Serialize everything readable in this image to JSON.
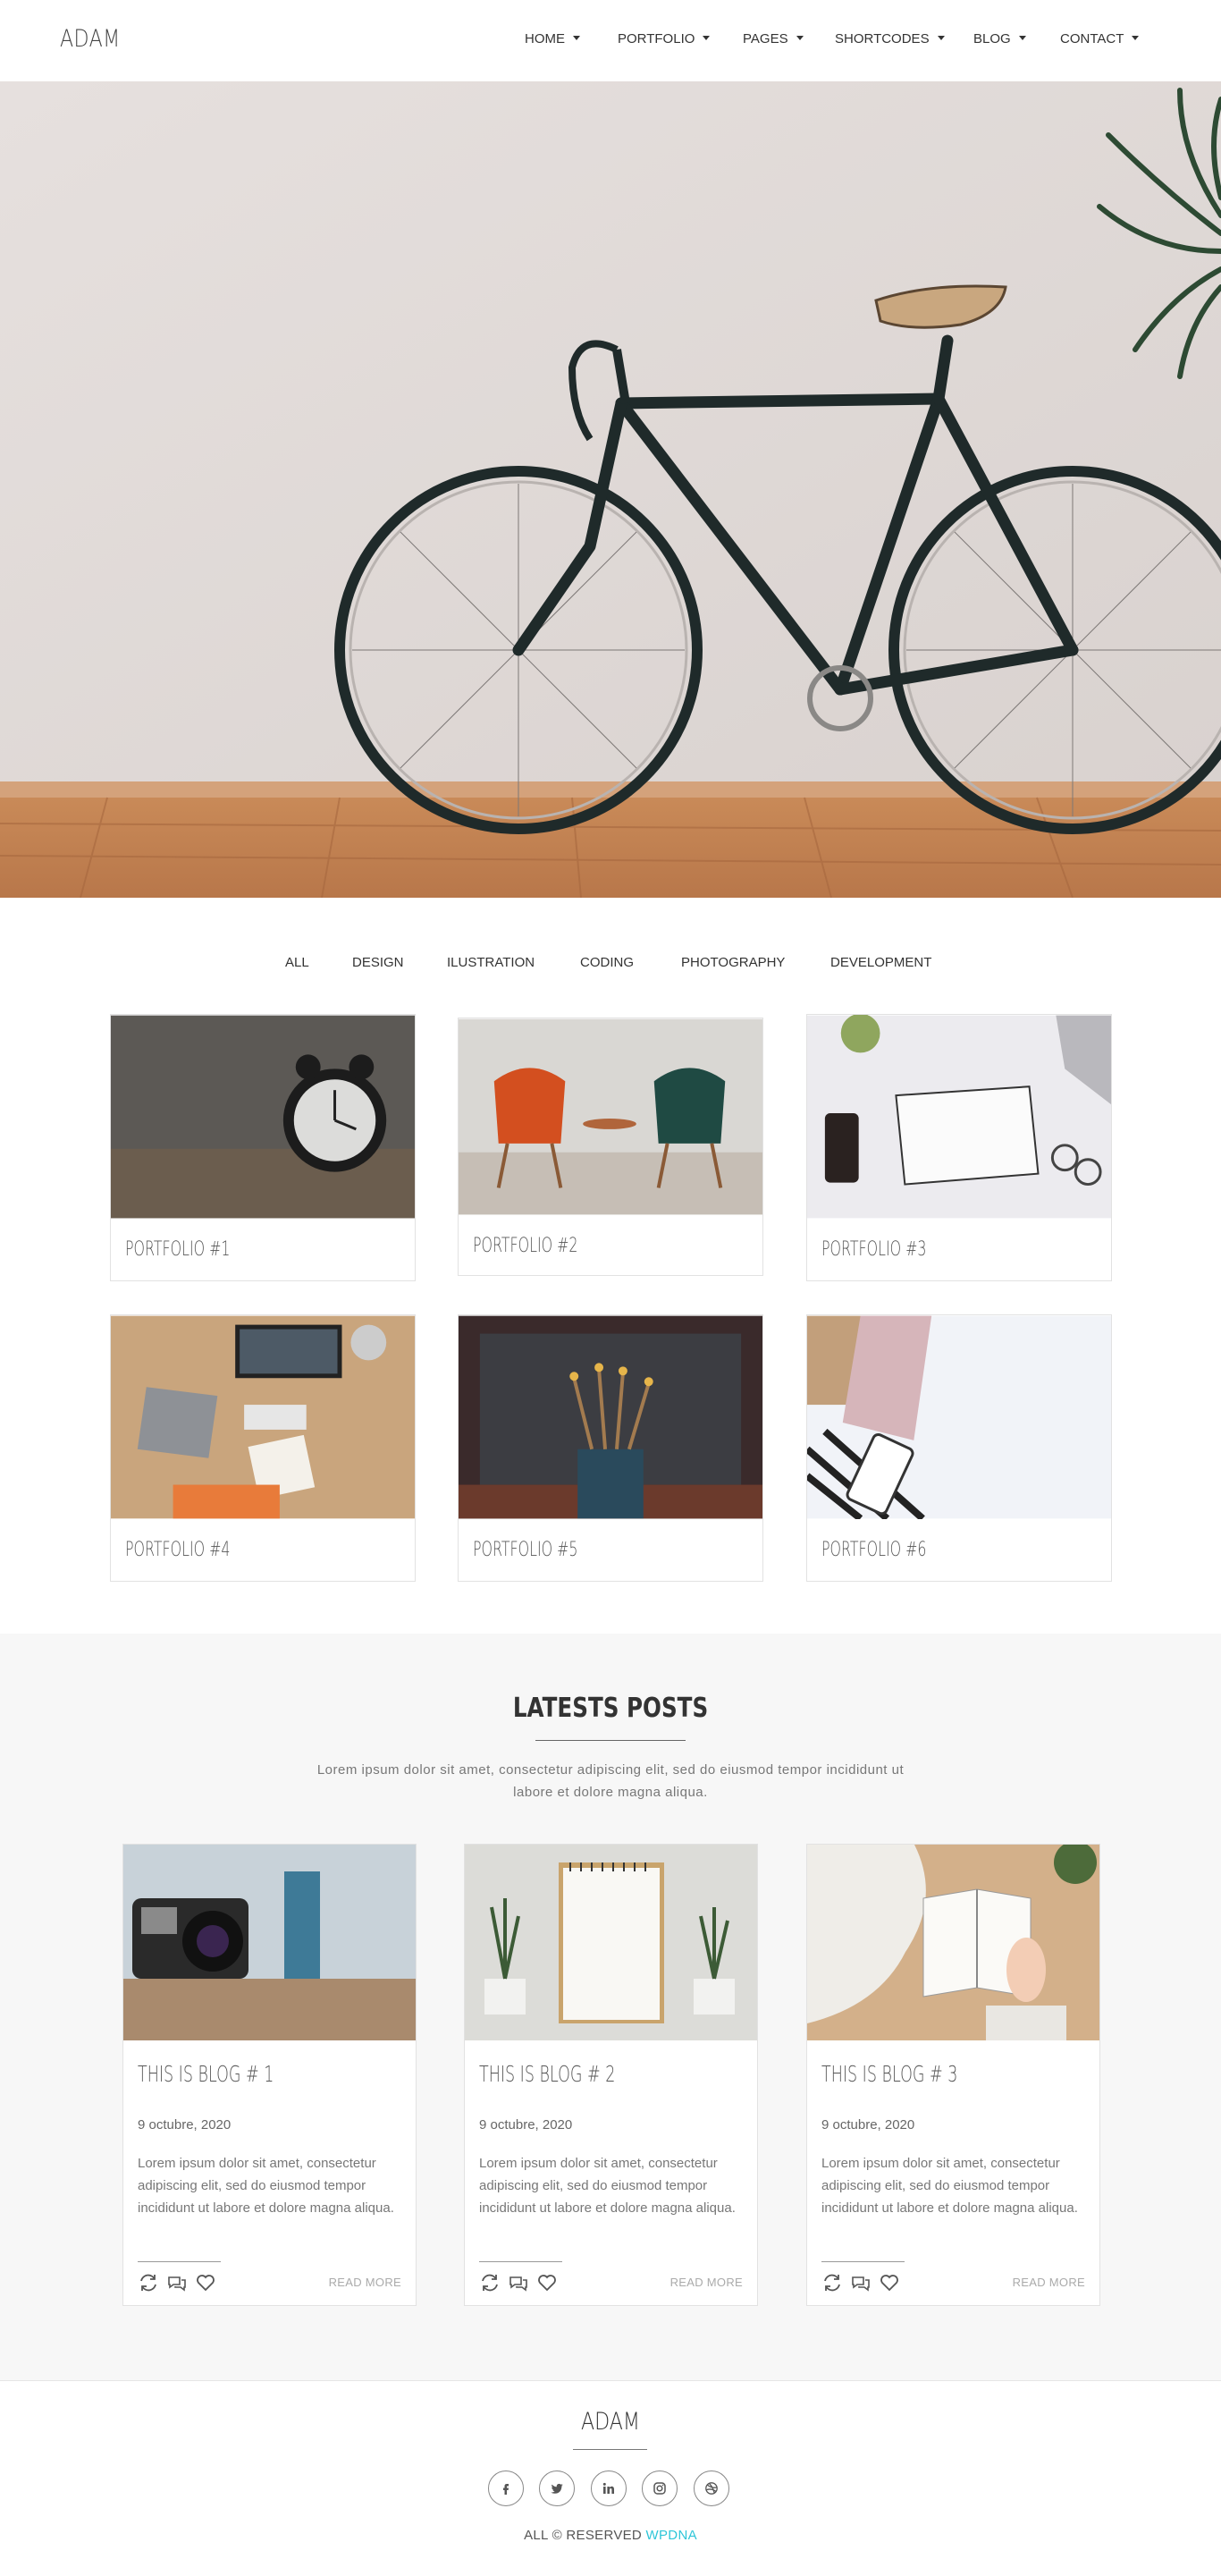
{
  "header": {
    "logo": "ADAM",
    "nav": [
      {
        "label": "HOME"
      },
      {
        "label": "PORTFOLIO"
      },
      {
        "label": "PAGES"
      },
      {
        "label": "SHORTCODES"
      },
      {
        "label": "BLOG"
      },
      {
        "label": "CONTACT"
      }
    ]
  },
  "filters": [
    "ALL",
    "DESIGN",
    "ILUSTRATION",
    "CODING",
    "PHOTOGRAPHY",
    "DEVELOPMENT"
  ],
  "portfolio": [
    {
      "title": "PORTFOLIO #1"
    },
    {
      "title": "PORTFOLIO #2"
    },
    {
      "title": "PORTFOLIO #3"
    },
    {
      "title": "PORTFOLIO #4"
    },
    {
      "title": "PORTFOLIO #5"
    },
    {
      "title": "PORTFOLIO #6"
    }
  ],
  "blog": {
    "heading": "LATESTS POSTS",
    "subtitle": "Lorem ipsum dolor sit amet, consectetur adipiscing elit, sed do eiusmod tempor incididunt ut labore et dolore magna aliqua.",
    "posts": [
      {
        "title": "THIS IS BLOG # 1",
        "date": "9 octubre, 2020",
        "excerpt": "Lorem ipsum dolor sit amet, consectetur adipiscing elit, sed do eiusmod tempor incididunt ut labore et dolore magna aliqua.",
        "read_more": "READ MORE"
      },
      {
        "title": "THIS IS BLOG # 2",
        "date": "9 octubre, 2020",
        "excerpt": "Lorem ipsum dolor sit amet, consectetur adipiscing elit, sed do eiusmod tempor incididunt ut labore et dolore magna aliqua.",
        "read_more": "READ MORE"
      },
      {
        "title": "THIS IS BLOG # 3",
        "date": "9 octubre, 2020",
        "excerpt": "Lorem ipsum dolor sit amet, consectetur adipiscing elit, sed do eiusmod tempor incididunt ut labore et dolore magna aliqua.",
        "read_more": "READ MORE"
      }
    ],
    "post_icons": [
      "refresh-icon",
      "comments-icon",
      "heart-icon"
    ]
  },
  "footer": {
    "logo": "ADAM",
    "social": [
      "facebook-icon",
      "twitter-icon",
      "linkedin-icon",
      "instagram-icon",
      "dribbble-icon"
    ],
    "copyright_prefix": "ALL © RESERVED",
    "copyright_link": "WPDNA"
  },
  "colors": {
    "accent": "#2ec6d8",
    "blog_background": "#f7f7f7",
    "text": "#333333"
  }
}
